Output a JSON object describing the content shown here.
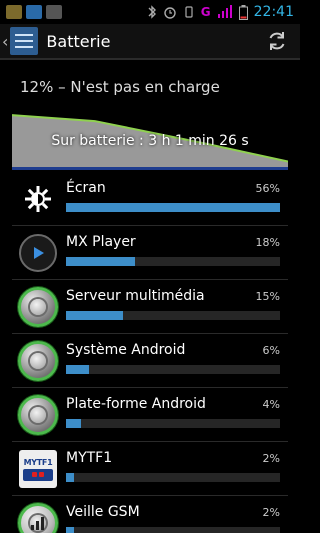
{
  "statusbar": {
    "time": "22:41",
    "network_label": "G",
    "icons": [
      "notification-icon",
      "replay-icon",
      "photo-icon",
      "bluetooth-icon",
      "alarm-icon",
      "vibrate-icon",
      "network-icon",
      "signal-icon",
      "battery-icon"
    ]
  },
  "actionbar": {
    "title": "Batterie",
    "up_glyph": "‹",
    "icon": "battery-settings-icon",
    "action_icon": "refresh-icon"
  },
  "summary": {
    "text": "12% – N'est pas en charge"
  },
  "graph": {
    "label": "Sur batterie : 3 h 1 min 26 s",
    "level_start": 0.98,
    "level_end": 0.12,
    "fill_color": "#999999",
    "line_color": "#8fd14f"
  },
  "accent": "#3d8ec9",
  "items": [
    {
      "name": "Écran",
      "percent": "56%",
      "value": 56,
      "icon": "brightness-icon"
    },
    {
      "name": "MX Player",
      "percent": "18%",
      "value": 18,
      "icon": "mx-player-icon"
    },
    {
      "name": "Serveur multimédia",
      "percent": "15%",
      "value": 15,
      "icon": "android-gear-icon"
    },
    {
      "name": "Système Android",
      "percent": "6%",
      "value": 6,
      "icon": "android-gear-icon"
    },
    {
      "name": "Plate-forme Android",
      "percent": "4%",
      "value": 4,
      "icon": "android-gear-icon"
    },
    {
      "name": "MYTF1",
      "percent": "2%",
      "value": 2,
      "icon": "mytf1-logo-icon",
      "logo_text": "MYTF1"
    },
    {
      "name": "Veille GSM",
      "percent": "2%",
      "value": 2,
      "icon": "cell-signal-icon"
    }
  ]
}
